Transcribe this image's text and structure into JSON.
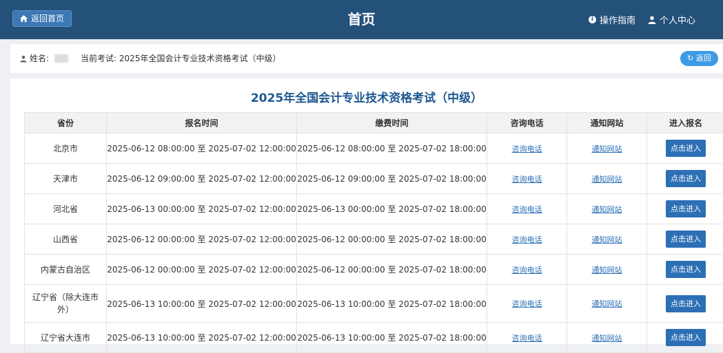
{
  "header": {
    "back_home": "返回首页",
    "title": "首页",
    "guide": "操作指南",
    "user_center": "个人中心"
  },
  "info": {
    "name_label": "姓名:",
    "current_exam": "当前考试: 2025年全国会计专业技术资格考试（中级）",
    "return_label": "返回"
  },
  "main": {
    "exam_title": "2025年全国会计专业技术资格考试（中级）",
    "columns": [
      "省份",
      "报名时间",
      "缴费时间",
      "咨询电话",
      "通知网站",
      "进入报名"
    ],
    "rows": [
      {
        "province": "北京市",
        "reg": "2025-06-12 08:00:00 至 2025-07-02 12:00:00",
        "pay": "2025-06-12 08:00:00 至 2025-07-02 18:00:00",
        "phone": "咨询电话",
        "site": "通知网站",
        "enter": "点击进入"
      },
      {
        "province": "天津市",
        "reg": "2025-06-12 09:00:00 至 2025-07-02 12:00:00",
        "pay": "2025-06-12 09:00:00 至 2025-07-02 18:00:00",
        "phone": "咨询电话",
        "site": "通知网站",
        "enter": "点击进入"
      },
      {
        "province": "河北省",
        "reg": "2025-06-13 00:00:00 至 2025-07-02 12:00:00",
        "pay": "2025-06-13 00:00:00 至 2025-07-02 18:00:00",
        "phone": "咨询电话",
        "site": "通知网站",
        "enter": "点击进入"
      },
      {
        "province": "山西省",
        "reg": "2025-06-12 00:00:00 至 2025-07-02 12:00:00",
        "pay": "2025-06-12 00:00:00 至 2025-07-02 18:00:00",
        "phone": "咨询电话",
        "site": "通知网站",
        "enter": "点击进入"
      },
      {
        "province": "内蒙古自治区",
        "reg": "2025-06-12 00:00:00 至 2025-07-02 12:00:00",
        "pay": "2025-06-12 00:00:00 至 2025-07-02 18:00:00",
        "phone": "咨询电话",
        "site": "通知网站",
        "enter": "点击进入"
      },
      {
        "province": "辽宁省（除大连市外）",
        "reg": "2025-06-13 10:00:00 至 2025-07-02 12:00:00",
        "pay": "2025-06-13 10:00:00 至 2025-07-02 18:00:00",
        "phone": "咨询电话",
        "site": "通知网站",
        "enter": "点击进入"
      },
      {
        "province": "辽宁省大连市",
        "reg": "2025-06-13 10:00:00 至 2025-07-02 12:00:00",
        "pay": "2025-06-13 10:00:00 至 2025-07-02 18:00:00",
        "phone": "咨询电话",
        "site": "通知网站",
        "enter": "点击进入"
      }
    ]
  }
}
